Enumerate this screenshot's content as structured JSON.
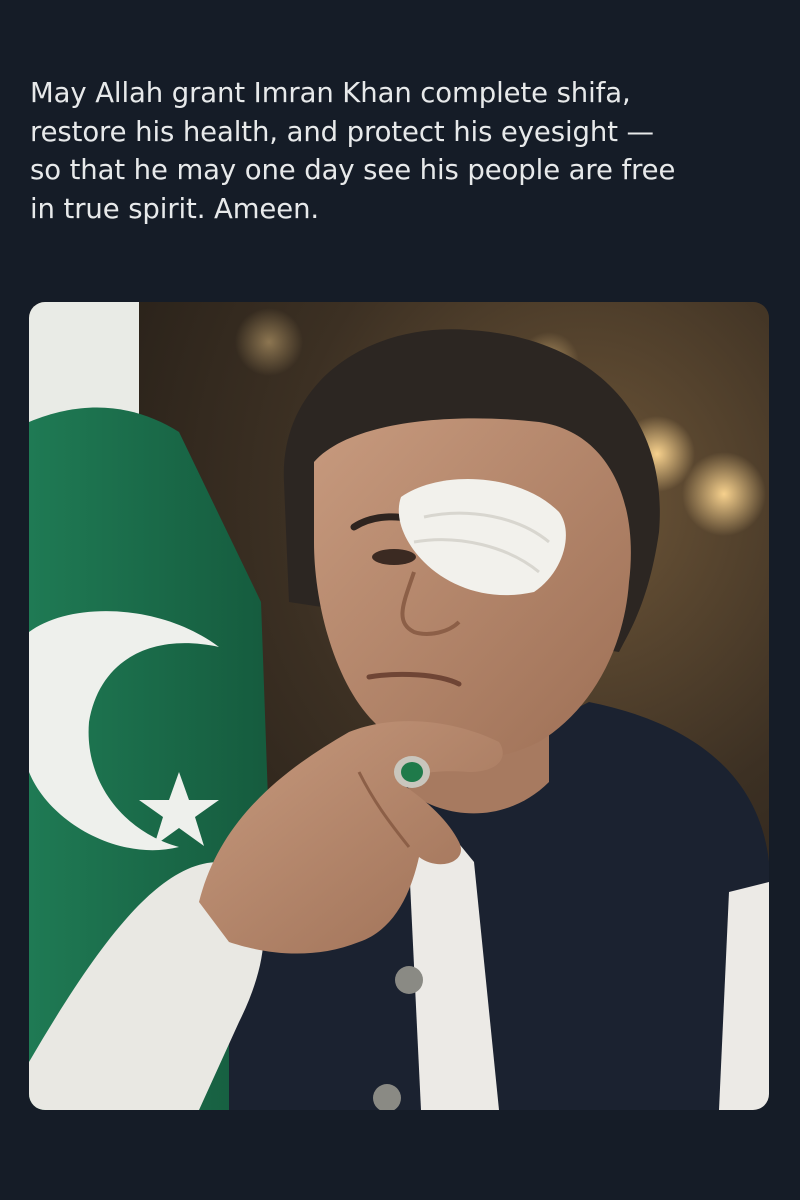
{
  "post": {
    "text_lines": [
      "May Allah grant Imran Khan complete shifa,",
      "restore his health, and protect his eyesight —",
      "so that he may one day see his people are free",
      "in true spirit. Ameen."
    ]
  },
  "colors": {
    "page_background": "#151c27",
    "text": "#e7e9ea",
    "flag_green": "#1b6b4a",
    "flag_white": "#eef0ec",
    "waistcoat_navy": "#1b2230",
    "bandage": "#f2f1ec"
  },
  "photo": {
    "icon": "photo-icon",
    "subject": "man-with-eye-patch",
    "elements": [
      "pakistan-flag",
      "eye-patch",
      "emerald-ring",
      "navy-waistcoat"
    ]
  }
}
